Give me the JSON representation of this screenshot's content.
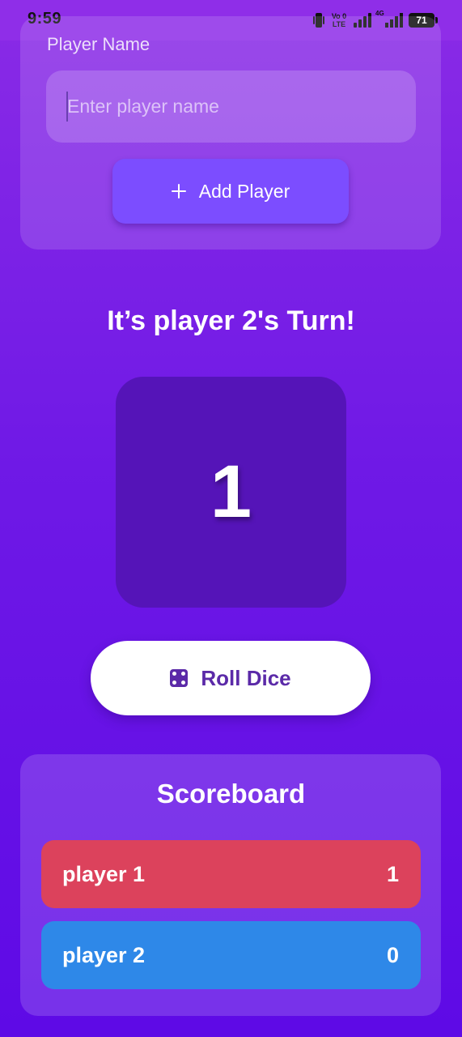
{
  "status_bar": {
    "time": "9:59",
    "volte_line1": "Vo 0",
    "volte_line2": "LTE",
    "network_tag": "4G",
    "battery": "71",
    "icons": [
      "vibrate-icon",
      "volte-icon",
      "signal-icon",
      "network-4g-icon",
      "battery-icon"
    ]
  },
  "add_player": {
    "label": "Player Name",
    "input_placeholder": "Enter player name",
    "input_value": "",
    "button_label": "Add Player",
    "button_icon": "plus-icon"
  },
  "game": {
    "turn_text": "It’s player 2's Turn!",
    "dice_value": "1",
    "roll_button_label": "Roll Dice",
    "roll_button_icon": "dice-icon"
  },
  "scoreboard": {
    "title": "Scoreboard",
    "players": [
      {
        "name": "player 1",
        "score": "1",
        "color": "#dc425c"
      },
      {
        "name": "player 2",
        "score": "0",
        "color": "#2e88e8"
      }
    ]
  },
  "colors": {
    "background_top": "#8a2be6",
    "background_bottom": "#5e0ae6",
    "add_button": "#7c4dff",
    "dice_box": "#5514b8",
    "roll_label": "#5b2aa8"
  }
}
